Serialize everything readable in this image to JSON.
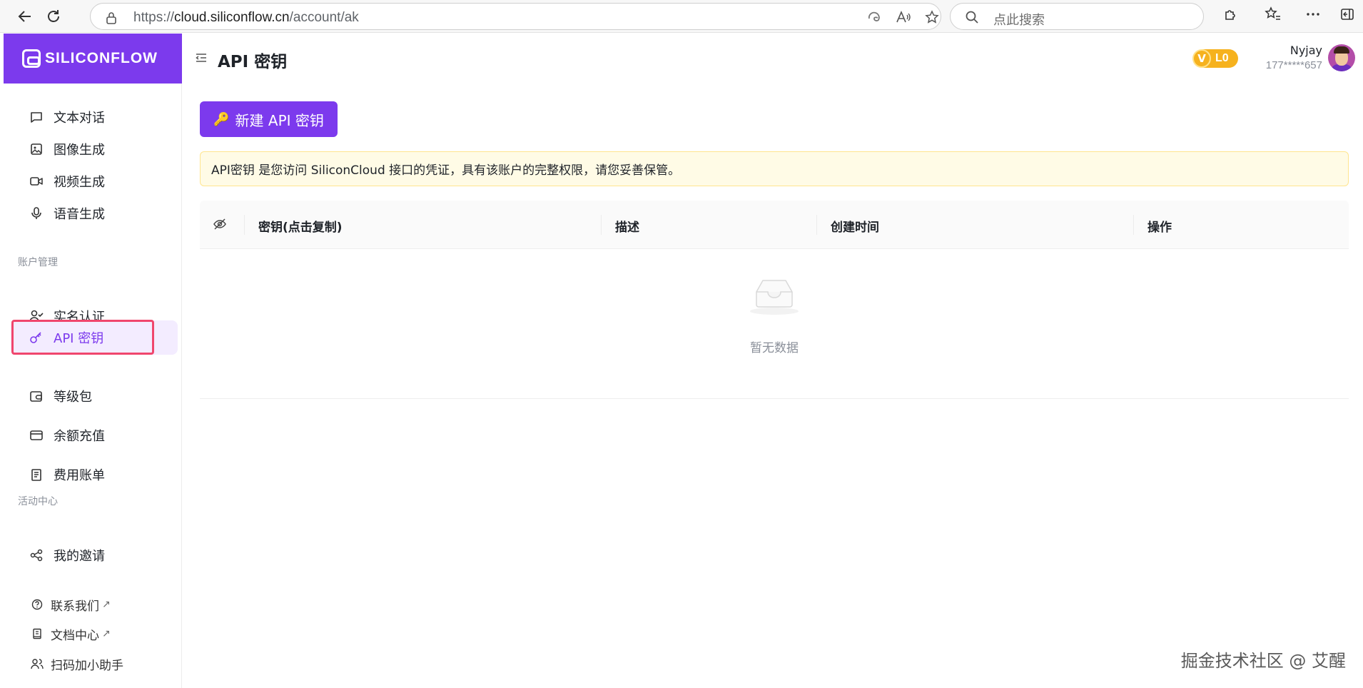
{
  "browser": {
    "url_prefix": "https://",
    "url_domain": "cloud.siliconflow.cn",
    "url_path": "/account/ak",
    "search_placeholder": "点此搜索"
  },
  "brand": {
    "logo_text": "SILICONFLOW",
    "accent_color": "#7c3aed"
  },
  "sidebar": {
    "top_items": [
      {
        "label": "文本对话",
        "icon": "chat-icon"
      },
      {
        "label": "图像生成",
        "icon": "image-icon"
      },
      {
        "label": "视频生成",
        "icon": "video-icon"
      },
      {
        "label": "语音生成",
        "icon": "microphone-icon"
      }
    ],
    "account_section_label": "账户管理",
    "account_items": [
      {
        "label": "实名认证",
        "icon": "user-check-icon"
      },
      {
        "label": "API 密钥",
        "icon": "key-icon",
        "active": true
      },
      {
        "label": "等级包",
        "icon": "wallet-icon"
      },
      {
        "label": "余额充值",
        "icon": "credit-card-icon"
      },
      {
        "label": "费用账单",
        "icon": "receipt-icon"
      }
    ],
    "activity_section_label": "活动中心",
    "activity_items": [
      {
        "label": "我的邀请",
        "icon": "share-icon"
      }
    ],
    "footer_items": [
      {
        "label": "联系我们",
        "icon": "help-circle-icon",
        "external": "↗"
      },
      {
        "label": "文档中心",
        "icon": "book-icon",
        "external": "↗"
      },
      {
        "label": "扫码加小助手",
        "icon": "users-icon",
        "external": ""
      }
    ]
  },
  "header": {
    "title": "API 密钥",
    "level_badge_letter": "V",
    "level_badge": "L0",
    "user_name": "Nyjay",
    "user_phone": "177*****657"
  },
  "main": {
    "new_key_button": "新建 API 密钥",
    "new_key_emoji": "🔑",
    "notice": "API密钥 是您访问 SiliconCloud 接口的凭证，具有该账户的完整权限，请您妥善保管。",
    "table": {
      "columns": [
        "密钥(点击复制)",
        "描述",
        "创建时间",
        "操作"
      ],
      "rows": [],
      "empty_text": "暂无数据"
    }
  },
  "watermark": "掘金技术社区 @ 艾醒"
}
